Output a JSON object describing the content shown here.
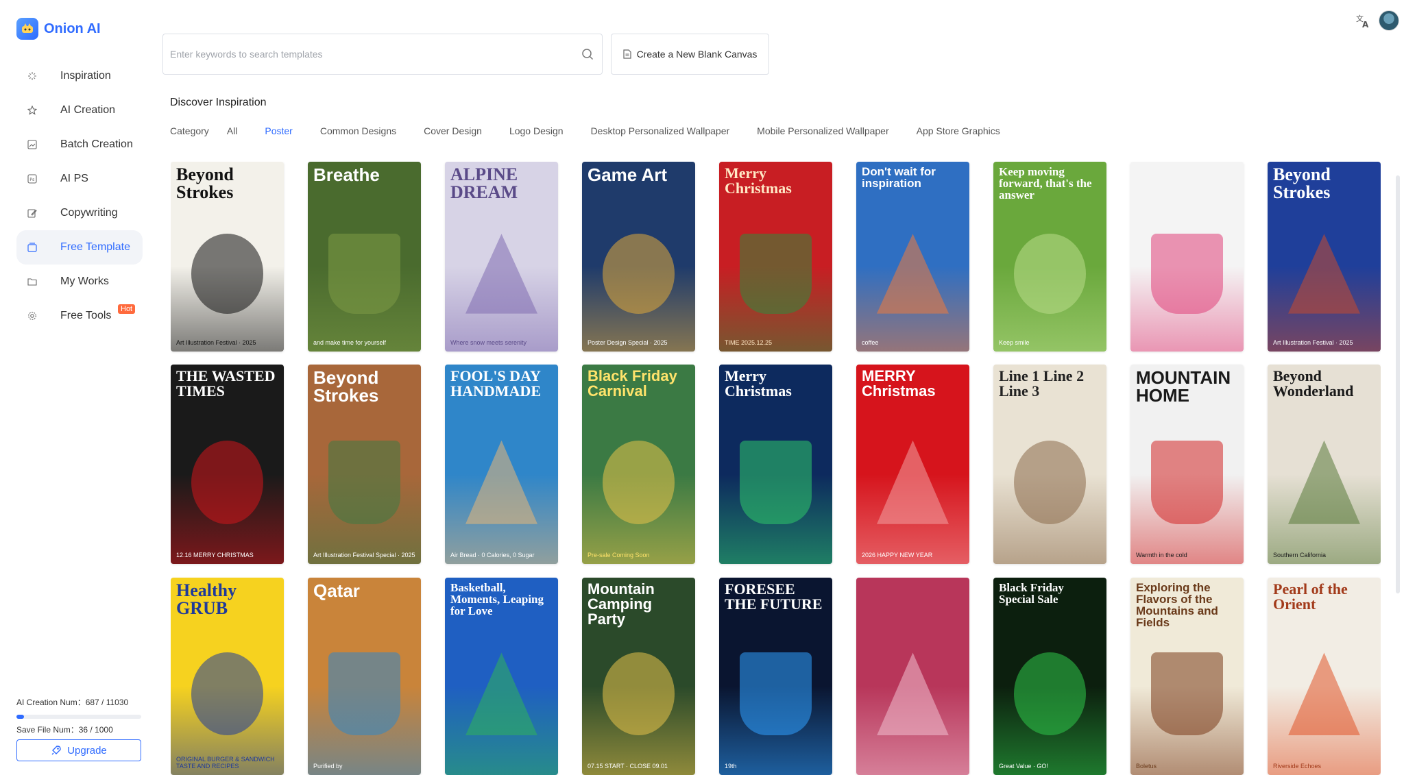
{
  "brand": {
    "name": "Onion AI"
  },
  "nav": [
    {
      "label": "Inspiration",
      "icon": "sparkle-icon"
    },
    {
      "label": "AI Creation",
      "icon": "star-icon"
    },
    {
      "label": "Batch Creation",
      "icon": "image-icon"
    },
    {
      "label": "AI PS",
      "icon": "ps-icon"
    },
    {
      "label": "Copywriting",
      "icon": "edit-icon"
    },
    {
      "label": "Free Template",
      "icon": "template-icon",
      "active": true
    },
    {
      "label": "My Works",
      "icon": "folder-icon"
    },
    {
      "label": "Free Tools",
      "icon": "gear-icon",
      "badge": "Hot"
    }
  ],
  "quota": {
    "ai_creation_label": "AI Creation Num：",
    "ai_creation_value": "687 / 11030",
    "ai_creation_fraction": 0.062,
    "save_file_label": "Save File Num：",
    "save_file_value": "36 / 1000",
    "save_file_fraction": 0.036
  },
  "upgrade_label": "Upgrade",
  "search": {
    "placeholder": "Enter keywords to search templates"
  },
  "blank_canvas_label": "Create a New Blank Canvas",
  "discover_title": "Discover Inspiration",
  "categories": {
    "label": "Category",
    "items": [
      "All",
      "Poster",
      "Common Designs",
      "Cover Design",
      "Logo Design",
      "Desktop Personalized Wallpaper",
      "Mobile Personalized Wallpaper",
      "App Store Graphics"
    ],
    "active": "Poster"
  },
  "colors": {
    "accent": "#2f6bff",
    "hot": "#ff6a3d"
  },
  "templates": [
    [
      {
        "title": "Beyond Strokes",
        "sub": "Art Illustration Festival · 2025",
        "bg": "#f3f1ea",
        "fg": "#111111",
        "accent": "#111111"
      },
      {
        "title": "Breathe",
        "sub": "and make time for yourself",
        "bg": "#4a6b2e",
        "fg": "#ffffff",
        "accent": "#7d9a45"
      },
      {
        "title": "ALPINE DREAM",
        "sub": "Where snow meets serenity",
        "bg": "#d7d3e6",
        "fg": "#5a4a88",
        "accent": "#7f6bb0"
      },
      {
        "title": "Game Art",
        "sub": "Poster Design Special · 2025",
        "bg": "#1f3b6b",
        "fg": "#ffffff",
        "accent": "#e0a93b"
      },
      {
        "title": "Merry Christmas",
        "sub": "TIME 2025.12.25",
        "bg": "#c81e23",
        "fg": "#ffe9c6",
        "accent": "#2f8a3c"
      },
      {
        "title": "Don't wait for inspiration",
        "sub": "coffee",
        "bg": "#2f6fc2",
        "fg": "#ffffff",
        "accent": "#f07a3a"
      },
      {
        "title": "Keep moving forward, that's the answer",
        "sub": "Keep smile",
        "bg": "#6aa83c",
        "fg": "#ffffff",
        "accent": "#b9dd8a"
      },
      {
        "title": "",
        "sub": "",
        "bg": "#f4f4f4",
        "fg": "#333333",
        "accent": "#e0427a"
      },
      {
        "title": "Beyond Strokes",
        "sub": "Art Illustration Festival · 2025",
        "bg": "#1f3f9a",
        "fg": "#ffffff",
        "accent": "#c74a2e"
      }
    ],
    [
      {
        "title": "THE WASTED TIMES",
        "sub": "12.16 MERRY CHRISTMAS",
        "bg": "#1a1a1a",
        "fg": "#ffffff",
        "accent": "#d2161c"
      },
      {
        "title": "Beyond Strokes",
        "sub": "Art Illustration Festival Special · 2025",
        "bg": "#a8673a",
        "fg": "#ffffff",
        "accent": "#3e7a44"
      },
      {
        "title": "FOOL'S DAY HANDMADE",
        "sub": "Air Bread · 0 Calories, 0 Sugar",
        "bg": "#2f86c9",
        "fg": "#ffffff",
        "accent": "#e7b677"
      },
      {
        "title": "Black Friday Carnival",
        "sub": "Pre-sale Coming Soon",
        "bg": "#3b7a44",
        "fg": "#ffe36b",
        "accent": "#e7c24a"
      },
      {
        "title": "Merry Christmas",
        "sub": "",
        "bg": "#0d2a5e",
        "fg": "#ffffff",
        "accent": "#2fc96a"
      },
      {
        "title": "MERRY Christmas",
        "sub": "2026 HAPPY NEW YEAR",
        "bg": "#d6141c",
        "fg": "#ffffff",
        "accent": "#f2a0a3"
      },
      {
        "title": "Line 1 Line 2 Line 3",
        "sub": "",
        "bg": "#e9e2d3",
        "fg": "#222222",
        "accent": "#8a6a4a"
      },
      {
        "title": "MOUNTAIN HOME",
        "sub": "Warmth in the cold",
        "bg": "#f1f1f1",
        "fg": "#1a1a1a",
        "accent": "#d22626"
      },
      {
        "title": "Beyond Wonderland",
        "sub": "Southern California",
        "bg": "#e6e0d4",
        "fg": "#1a1a1a",
        "accent": "#5a7a3a"
      }
    ],
    [
      {
        "title": "Healthy GRUB",
        "sub": "ORIGINAL BURGER & SANDWICH TASTE AND RECIPES",
        "bg": "#f6d21f",
        "fg": "#1f3a9a",
        "accent": "#1f3a9a"
      },
      {
        "title": "Qatar",
        "sub": "Purified by",
        "bg": "#c9843a",
        "fg": "#ffffff",
        "accent": "#2f86c9"
      },
      {
        "title": "Basketball, Moments, Leaping for Love",
        "sub": "",
        "bg": "#1f5fc2",
        "fg": "#ffffff",
        "accent": "#2fb35a"
      },
      {
        "title": "Mountain Camping Party",
        "sub": "07.15 START · CLOSE 09.01",
        "bg": "#2b4a2a",
        "fg": "#ffffff",
        "accent": "#e7c24a"
      },
      {
        "title": "FORESEE THE FUTURE",
        "sub": "19th",
        "bg": "#0a1530",
        "fg": "#ffffff",
        "accent": "#2fa0ff"
      },
      {
        "title": "",
        "sub": "",
        "bg": "#b8365a",
        "fg": "#ffffff",
        "accent": "#f0c0d0"
      },
      {
        "title": "Black Friday Special Sale",
        "sub": "Great Value · GO!",
        "bg": "#0c1f0e",
        "fg": "#ffffff",
        "accent": "#2fc94a"
      },
      {
        "title": "Exploring the Flavors of the Mountains and Fields",
        "sub": "Boletus",
        "bg": "#f0ead8",
        "fg": "#6a3a1a",
        "accent": "#7a3a1a"
      },
      {
        "title": "Pearl of the Orient",
        "sub": "Riverside Echoes",
        "bg": "#f2ede4",
        "fg": "#a23a1a",
        "accent": "#e0552a"
      }
    ]
  ]
}
